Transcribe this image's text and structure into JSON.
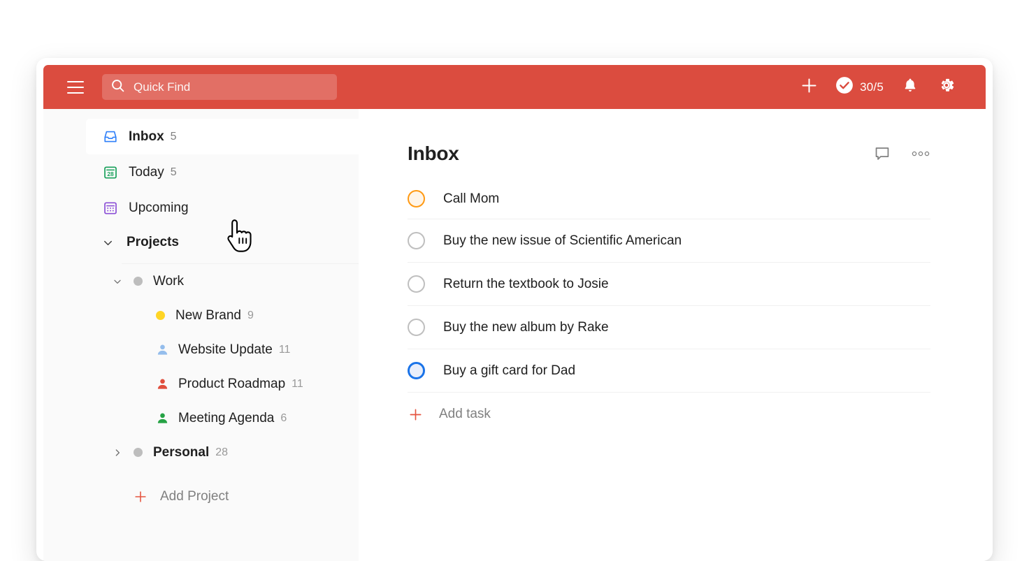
{
  "topbar": {
    "menu_icon": "hamburger-menu-icon",
    "search": {
      "icon": "search-icon",
      "placeholder": "Quick Find",
      "value": ""
    },
    "add_icon": "plus-icon",
    "karma": {
      "icon": "check-circle-icon",
      "value": "30/5"
    },
    "notifications_icon": "bell-icon",
    "settings_icon": "gear-icon",
    "background_color": "#db4c3f"
  },
  "sidebar": {
    "nav_items": [
      {
        "label": "Inbox",
        "count": "5",
        "icon": "inbox-tray-icon",
        "selected": true
      },
      {
        "label": "Today",
        "count": "5",
        "icon": "calendar-28-icon",
        "selected": false
      },
      {
        "label": "Upcoming",
        "count": "",
        "icon": "calendar-grid-icon",
        "selected": false
      }
    ],
    "projects_header": {
      "label": "Projects",
      "chevron": "chevron-down-icon",
      "expanded": true
    },
    "projects": [
      {
        "label": "Work",
        "count": "",
        "marker": "dot",
        "color": "#bdbdbd",
        "twisty": "chevron-down-icon",
        "expanded": true,
        "nested": false
      },
      {
        "label": "New Brand",
        "count": "9",
        "marker": "dot",
        "color": "#ffd525",
        "twisty": "",
        "nested": true
      },
      {
        "label": "Website Update",
        "count": "11",
        "marker": "person",
        "color": "#94bdec",
        "twisty": "",
        "nested": true
      },
      {
        "label": "Product Roadmap",
        "count": "11",
        "marker": "person",
        "color": "#e04e3d",
        "twisty": "",
        "nested": true
      },
      {
        "label": "Meeting Agenda",
        "count": "6",
        "marker": "person",
        "color": "#25a244",
        "twisty": "",
        "nested": true
      },
      {
        "label": "Personal",
        "count": "28",
        "marker": "dot",
        "color": "#bdbdbd",
        "twisty": "chevron-right-icon",
        "expanded": false,
        "nested": false
      }
    ],
    "add_project": {
      "label": "Add Project",
      "icon": "plus-icon",
      "color": "#e5543f"
    }
  },
  "content": {
    "title": "Inbox",
    "actions": [
      {
        "name": "comments-icon"
      },
      {
        "name": "more-options-icon"
      }
    ],
    "tasks": [
      {
        "text": "Call Mom",
        "checkbox_color": "orange"
      },
      {
        "text": "Buy the new issue of Scientific American",
        "checkbox_color": "gray"
      },
      {
        "text": "Return the textbook to Josie",
        "checkbox_color": "gray"
      },
      {
        "text": "Buy the new album by Rake",
        "checkbox_color": "gray"
      },
      {
        "text": "Buy a gift card for Dad",
        "checkbox_color": "blue"
      }
    ],
    "add_task": {
      "label": "Add task",
      "icon": "plus-icon"
    }
  },
  "cursor": {
    "type": "pointing-hand-cursor"
  }
}
